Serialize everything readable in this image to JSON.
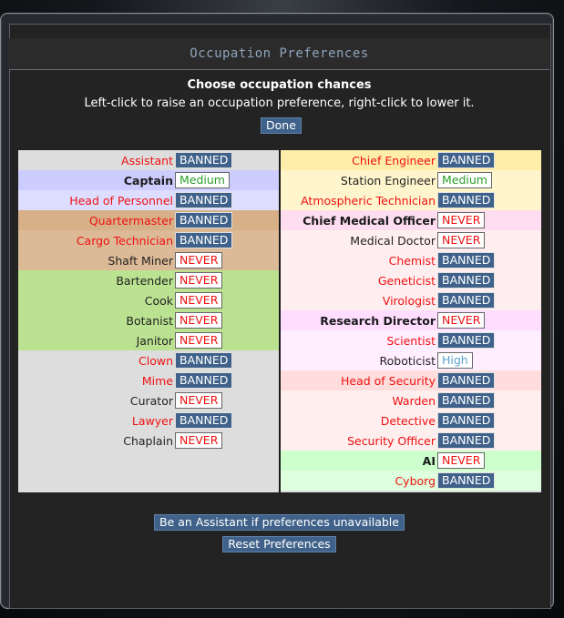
{
  "window": {
    "title": "Occupation Preferences"
  },
  "header": {
    "heading": "Choose occupation chances",
    "subheading": "Left-click to raise an occupation preference, right-click to lower it.",
    "done_label": "Done"
  },
  "colors": {
    "banned_bg": "#40628a",
    "never_text": "#ee1111",
    "medium_text": "#2a9d2a",
    "high_text": "#5aa0d0"
  },
  "left_jobs": [
    {
      "name": "Assistant",
      "pref": "BANNED",
      "style": "red",
      "bg": "#dddddd"
    },
    {
      "name": "Captain",
      "pref": "Medium",
      "style": "head",
      "bg": "#ccccff"
    },
    {
      "name": "Head of Personnel",
      "pref": "BANNED",
      "style": "red",
      "bg": "#ddddff"
    },
    {
      "name": "Quartermaster",
      "pref": "BANNED",
      "style": "red",
      "bg": "#d7b088"
    },
    {
      "name": "Cargo Technician",
      "pref": "BANNED",
      "style": "red",
      "bg": "#dcba97"
    },
    {
      "name": "Shaft Miner",
      "pref": "NEVER",
      "style": "black",
      "bg": "#dcba97"
    },
    {
      "name": "Bartender",
      "pref": "NEVER",
      "style": "black",
      "bg": "#bbe291"
    },
    {
      "name": "Cook",
      "pref": "NEVER",
      "style": "black",
      "bg": "#bbe291"
    },
    {
      "name": "Botanist",
      "pref": "NEVER",
      "style": "black",
      "bg": "#bbe291"
    },
    {
      "name": "Janitor",
      "pref": "NEVER",
      "style": "black",
      "bg": "#bbe291"
    },
    {
      "name": "Clown",
      "pref": "BANNED",
      "style": "red",
      "bg": "#dddddd"
    },
    {
      "name": "Mime",
      "pref": "BANNED",
      "style": "red",
      "bg": "#dddddd"
    },
    {
      "name": "Curator",
      "pref": "NEVER",
      "style": "black",
      "bg": "#dddddd"
    },
    {
      "name": "Lawyer",
      "pref": "BANNED",
      "style": "red",
      "bg": "#dddddd"
    },
    {
      "name": "Chaplain",
      "pref": "NEVER",
      "style": "black",
      "bg": "#dddddd"
    }
  ],
  "right_jobs": [
    {
      "name": "Chief Engineer",
      "pref": "BANNED",
      "style": "red",
      "bg": "#ffeeaa"
    },
    {
      "name": "Station Engineer",
      "pref": "Medium",
      "style": "black",
      "bg": "#fff5cc"
    },
    {
      "name": "Atmospheric Technician",
      "pref": "BANNED",
      "style": "red",
      "bg": "#fff5cc"
    },
    {
      "name": "Chief Medical Officer",
      "pref": "NEVER",
      "style": "head",
      "bg": "#ffddf0"
    },
    {
      "name": "Medical Doctor",
      "pref": "NEVER",
      "style": "black",
      "bg": "#ffeef0"
    },
    {
      "name": "Chemist",
      "pref": "BANNED",
      "style": "red",
      "bg": "#ffeef0"
    },
    {
      "name": "Geneticist",
      "pref": "BANNED",
      "style": "red",
      "bg": "#ffeef0"
    },
    {
      "name": "Virologist",
      "pref": "BANNED",
      "style": "red",
      "bg": "#ffeef0"
    },
    {
      "name": "Research Director",
      "pref": "NEVER",
      "style": "head",
      "bg": "#ffddff"
    },
    {
      "name": "Scientist",
      "pref": "BANNED",
      "style": "red",
      "bg": "#ffeeff"
    },
    {
      "name": "Roboticist",
      "pref": "High",
      "style": "black",
      "bg": "#ffeeff"
    },
    {
      "name": "Head of Security",
      "pref": "BANNED",
      "style": "red",
      "bg": "#ffdddd"
    },
    {
      "name": "Warden",
      "pref": "BANNED",
      "style": "red",
      "bg": "#ffeeee"
    },
    {
      "name": "Detective",
      "pref": "BANNED",
      "style": "red",
      "bg": "#ffeeee"
    },
    {
      "name": "Security Officer",
      "pref": "BANNED",
      "style": "red",
      "bg": "#ffeeee"
    },
    {
      "name": "AI",
      "pref": "NEVER",
      "style": "head",
      "bg": "#ccffcc"
    },
    {
      "name": "Cyborg",
      "pref": "BANNED",
      "style": "red",
      "bg": "#ddffdd"
    }
  ],
  "footer": {
    "assistant_fallback_label": "Be an Assistant if preferences unavailable",
    "reset_label": "Reset Preferences"
  }
}
